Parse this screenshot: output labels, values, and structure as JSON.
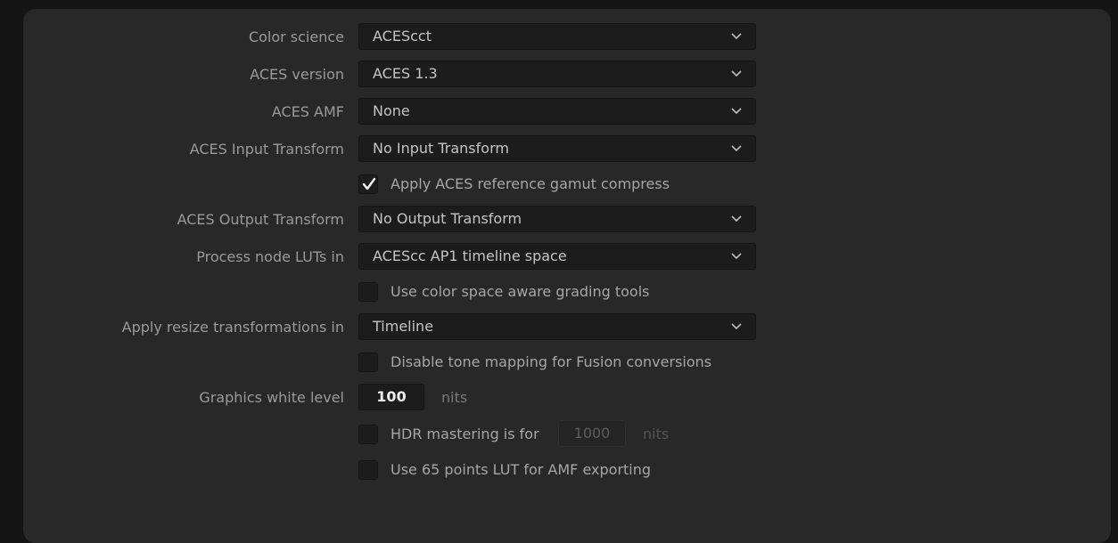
{
  "color_science": {
    "label": "Color science",
    "value": "ACEScct"
  },
  "aces_version": {
    "label": "ACES version",
    "value": "ACES 1.3"
  },
  "aces_amf": {
    "label": "ACES AMF",
    "value": "None"
  },
  "aces_input_transform": {
    "label": "ACES Input Transform",
    "value": "No Input Transform"
  },
  "gamut_compress": {
    "label": "Apply ACES reference gamut compress",
    "checked": true
  },
  "aces_output_transform": {
    "label": "ACES Output Transform",
    "value": "No Output Transform"
  },
  "process_node_luts": {
    "label": "Process node LUTs in",
    "value": "ACEScc AP1 timeline space"
  },
  "color_space_aware": {
    "label": "Use color space aware grading tools",
    "checked": false
  },
  "resize_transformations": {
    "label": "Apply resize transformations in",
    "value": "Timeline"
  },
  "disable_tone_mapping": {
    "label": "Disable tone mapping for Fusion conversions",
    "checked": false
  },
  "graphics_white_level": {
    "label": "Graphics white level",
    "value": "100",
    "unit": "nits"
  },
  "hdr_mastering": {
    "label": "HDR mastering is for",
    "value": "1000",
    "unit": "nits",
    "checked": false
  },
  "lut_65_points": {
    "label": "Use 65 points LUT for AMF exporting",
    "checked": false
  },
  "icons": {
    "dropdown": "chevron-down-icon",
    "check": "checkmark-icon"
  },
  "colors": {
    "background": "#141414",
    "panel": "#282828",
    "field": "#1c1c1c",
    "label": "#9a9a9a",
    "value": "#c4c4c4"
  }
}
